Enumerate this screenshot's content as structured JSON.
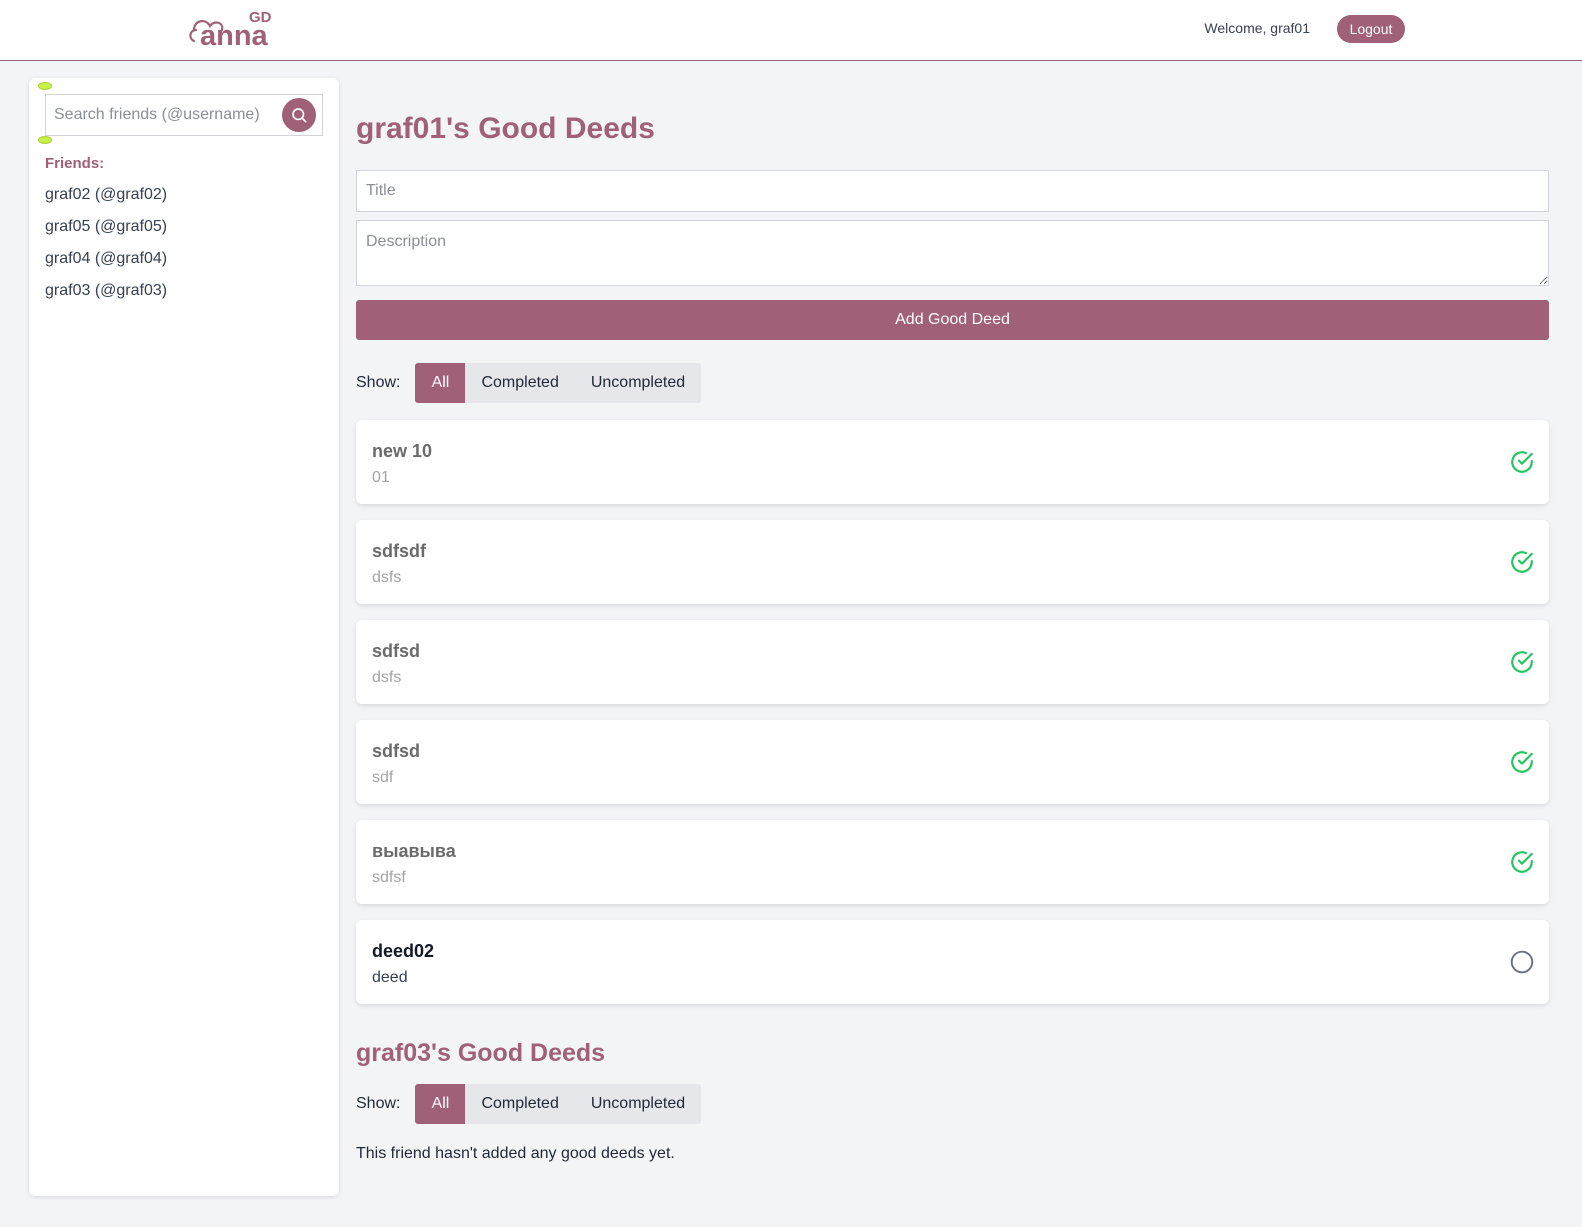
{
  "header": {
    "logo_text": "GD anna",
    "welcome": "Welcome, graf01",
    "logout_label": "Logout"
  },
  "sidebar": {
    "search_placeholder": "Search friends (@username)",
    "search_icon": "search-icon",
    "friends_title": "Friends:",
    "friends": [
      {
        "label": "graf02 (@graf02)"
      },
      {
        "label": "graf05 (@graf05)"
      },
      {
        "label": "graf04 (@graf04)"
      },
      {
        "label": "graf03 (@graf03)"
      }
    ]
  },
  "main": {
    "title": "graf01's Good Deeds",
    "form": {
      "title_placeholder": "Title",
      "description_placeholder": "Description",
      "add_label": "Add Good Deed"
    },
    "filter": {
      "label": "Show:",
      "options": [
        "All",
        "Completed",
        "Uncompleted"
      ],
      "selected": "All"
    },
    "deeds": [
      {
        "title": "new 10",
        "description": "01",
        "completed": true
      },
      {
        "title": "sdfsdf",
        "description": "dsfs",
        "completed": true
      },
      {
        "title": "sdfsd",
        "description": "dsfs",
        "completed": true
      },
      {
        "title": "sdfsd",
        "description": "sdf",
        "completed": true
      },
      {
        "title": "выавыва",
        "description": "sdfsf",
        "completed": true
      },
      {
        "title": "deed02",
        "description": "deed",
        "completed": false
      }
    ]
  },
  "friend_section": {
    "title": "graf03's Good Deeds",
    "filter": {
      "label": "Show:",
      "options": [
        "All",
        "Completed",
        "Uncompleted"
      ],
      "selected": "All"
    },
    "empty_message": "This friend hasn't added any good deeds yet."
  },
  "colors": {
    "brand": "#a06078",
    "completed": "#22c55e",
    "uncompleted": "#6b7280",
    "background": "#f3f4f6"
  }
}
